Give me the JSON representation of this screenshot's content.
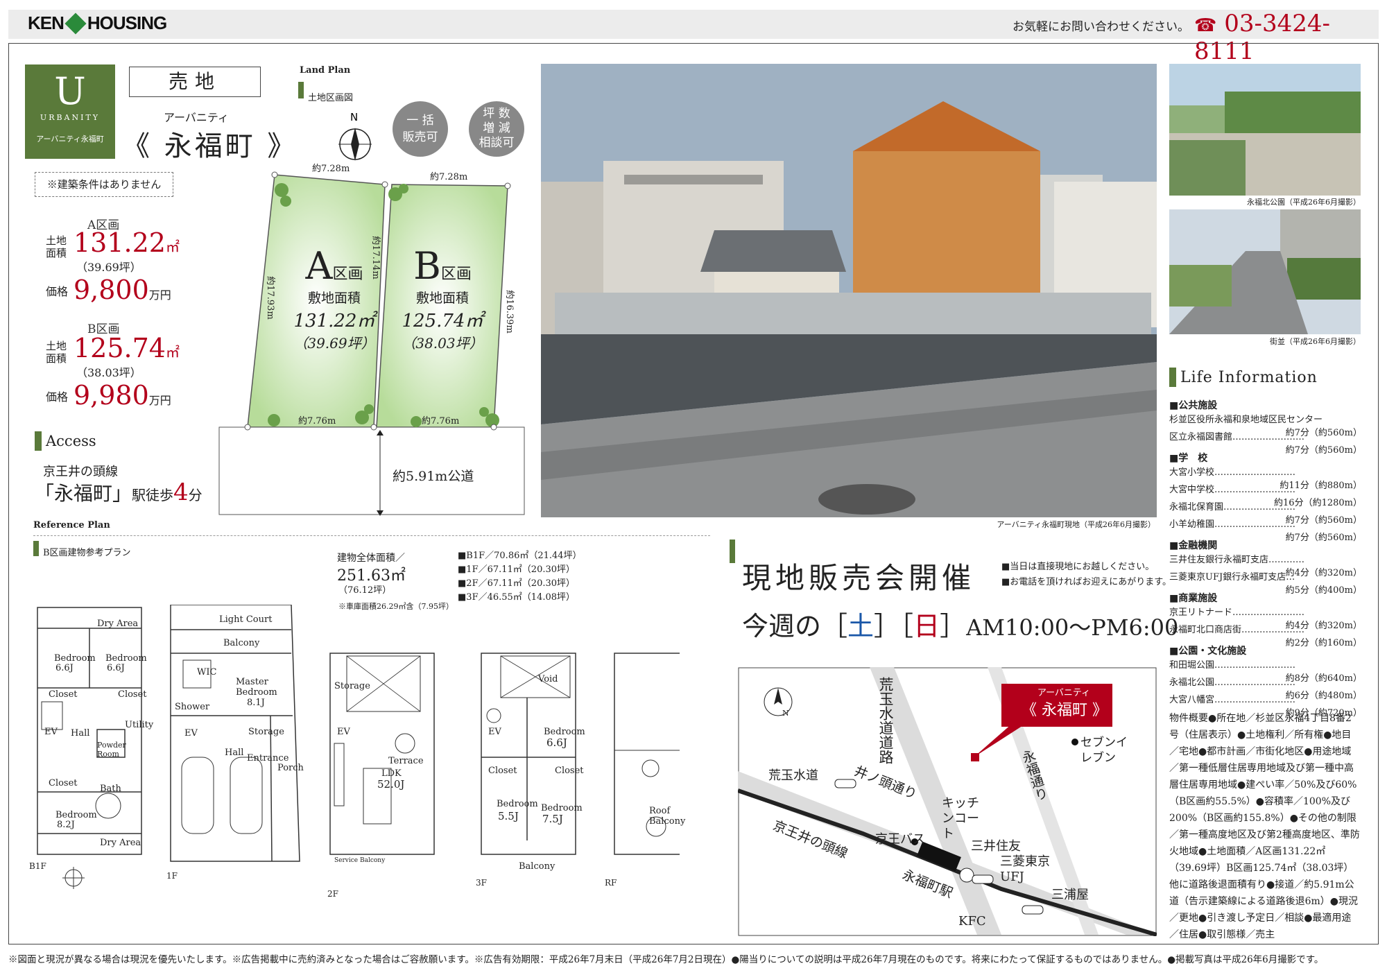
{
  "header": {
    "brand": "KEN",
    "brand2": "HOUSING",
    "inquiry": "お気軽にお問い合わせください。",
    "phone": "03-3424-8111"
  },
  "badge": {
    "letter": "U",
    "word": "URBANITY",
    "sub": "アーバニティ永福町"
  },
  "type_label": "売地",
  "title_ruby": "アーバニティ",
  "title": "《 永福町 》",
  "condition": "※建築条件はありません",
  "lotA": {
    "heading": "A区画",
    "area_label1": "土地",
    "area_label2": "面積",
    "area": "131.22",
    "unit": "㎡",
    "tsubo": "（39.69坪）",
    "price_label": "価格",
    "price": "9,800",
    "price_unit": "万円"
  },
  "lotB": {
    "heading": "B区画",
    "area_label1": "土地",
    "area_label2": "面積",
    "area": "125.74",
    "unit": "㎡",
    "tsubo": "（38.03坪）",
    "price_label": "価格",
    "price": "9,980",
    "price_unit": "万円"
  },
  "access": {
    "heading": "Access",
    "line": "京王井の頭線",
    "station": "「永福町」",
    "walk": "駅徒歩",
    "minutes": "4",
    "minutes_unit": "分"
  },
  "landplan": {
    "heading": "Land Plan",
    "sub": "土地区画図",
    "north": "N",
    "tags": [
      [
        "一 括",
        "販売可"
      ],
      [
        "坪 数",
        "増 減",
        "相談可"
      ]
    ],
    "dims": {
      "topA": "約7.28m",
      "topB": "約7.28m",
      "leftA": "約17.93m",
      "midAB": "約17.14m",
      "rightB": "約16.39m",
      "bottomA": "約7.76m",
      "bottomB": "約7.76m",
      "road": "約5.91m公道"
    },
    "A": {
      "big": "A",
      "ku": "区画",
      "label": "敷地面積",
      "area": "131.22㎡",
      "tsubo": "（39.69坪）"
    },
    "B": {
      "big": "B",
      "ku": "区画",
      "label": "敷地面積",
      "area": "125.74㎡",
      "tsubo": "（38.03坪）"
    }
  },
  "photos": {
    "main_caption": "アーバニティ永福町現地（平成26年6月撮影）",
    "park_caption": "永福北公園（平成26年6月撮影）",
    "street_caption": "街並（平成26年6月撮影）"
  },
  "reference": {
    "heading": "Reference Plan",
    "sub": "B区画建物参考プラン",
    "total_label": "建物全体面積／",
    "total": "251.63㎡",
    "total_tsubo": "（76.12坪）",
    "garage_note": "※車庫面積26.29㎡含（7.95坪）",
    "floors": [
      "B1F／70.86㎡（21.44坪）",
      "1F／67.11㎡（20.30坪）",
      "2F／67.11㎡（20.30坪）",
      "3F／46.55㎡（14.08坪）"
    ],
    "labels": [
      "B1F",
      "1F",
      "2F",
      "3F",
      "RF"
    ],
    "b1": [
      "Dry Area",
      "Bedroom",
      "6.6J",
      "Bedroom",
      "6.6J",
      "Closet",
      "Closet",
      "EV",
      "Hall",
      "Powder Room",
      "Utility",
      "Bath",
      "Closet",
      "Bedroom",
      "8.2J",
      "Dry Area"
    ],
    "f1": [
      "Light Court",
      "Balcony",
      "WIC",
      "Master Bedroom",
      "8.1J",
      "Shower",
      "EV",
      "Storage",
      "Hall",
      "Entrance",
      "Porch"
    ],
    "f2": [
      "Storage",
      "Terrace",
      "LDK",
      "52.0J",
      "Service Balcony",
      "EV"
    ],
    "f3": [
      "Void",
      "EV",
      "Bedroom",
      "6.6J",
      "Closet",
      "Closet",
      "Bedroom",
      "5.5J",
      "Bedroom",
      "7.5J",
      "Balcony"
    ],
    "rf": [
      "Roof Balcony"
    ]
  },
  "event": {
    "title": "現地販売会開催",
    "notes": [
      "■当日は直接現地にお越しください。",
      "■お電話を頂ければお迎えにあがります。"
    ],
    "week": "今週の",
    "sat": "土",
    "sun": "日",
    "time": "AM10:00～PM6:00"
  },
  "map": {
    "north": "N",
    "pin_ruby": "アーバニティ",
    "pin": "《 永福町 》",
    "labels": [
      "荒玉水道道路",
      "荒玉水道",
      "井ノ頭通り",
      "京王井の頭線",
      "京王バス",
      "キッチンコート",
      "三井住友",
      "三菱東京UFJ",
      "永福町駅",
      "KFC",
      "三浦屋",
      "セブンイレブン",
      "永福通り"
    ]
  },
  "life": {
    "heading": "Life Information",
    "groups": [
      {
        "title": "■公共施設",
        "rows": [
          [
            "杉並区役所永福和泉地域区民センター",
            "約7分（約560m）"
          ],
          [
            "区立永福図書館……………………",
            "約7分（約560m）"
          ]
        ]
      },
      {
        "title": "■学　校",
        "rows": [
          [
            "大宮小学校………………………",
            "約11分（約880m）"
          ],
          [
            "大宮中学校………………………",
            "約16分（約1280m）"
          ],
          [
            "永福北保育園……………………",
            "約7分（約560m）"
          ],
          [
            "小羊幼稚園………………………",
            "約7分（約560m）"
          ]
        ]
      },
      {
        "title": "■金融機関",
        "rows": [
          [
            "三井住友銀行永福町支店…………",
            "約4分（約320m）"
          ],
          [
            "三菱東京UFJ銀行永福町支店…",
            "約5分（約400m）"
          ]
        ]
      },
      {
        "title": "■商業施設",
        "rows": [
          [
            "京王リトナード……………………",
            "約4分（約320m）"
          ],
          [
            "永福町北口商店街…………………",
            "約2分（約160m）"
          ]
        ]
      },
      {
        "title": "■公園・文化施設",
        "rows": [
          [
            "和田堀公園………………………",
            "約8分（約640m）"
          ],
          [
            "永福北公園………………………",
            "約6分（約480m）"
          ],
          [
            "大宮八幡宮………………………",
            "約9分（約720m）"
          ]
        ]
      }
    ],
    "overview": "物件概要●所在地／杉並区永福4丁目8番2号（住居表示）●土地権利／所有権●地目／宅地●都市計画／市街化地区●用途地域／第一種低層住居専用地域及び第一種中高層住居専用地域●建ぺい率／50%及び60%（B区画約55.5%）●容積率／100%及び200%（B区画約155.8%）●その他の制限／第一種高度地区及び第2種高度地区、準防火地域●土地面積／A区画131.22㎡（39.69坪）B区画125.74㎡（38.03坪）他に道路後退面積有り●接道／約5.91m公道（告示建築線による道路後退6m）●現況／更地●引き渡し予定日／相談●最適用途／住居●取引態様／売主"
  },
  "footer": "※図面と現況が異なる場合は現況を優先いたします。※広告掲載中に売約済みとなった場合はご容赦願います。※広告有効期限：平成26年7月末日（平成26年7月2日現在）●陽当りについての説明は平成26年7月現在のものです。将来にわたって保証するものではありません。●掲載写真は平成26年6月撮影です。",
  "colors": {
    "accent_red": "#b3001b",
    "brand_green": "#5a7a3a",
    "tag_gray": "#888888",
    "lot_green": "#c9e4b0"
  }
}
